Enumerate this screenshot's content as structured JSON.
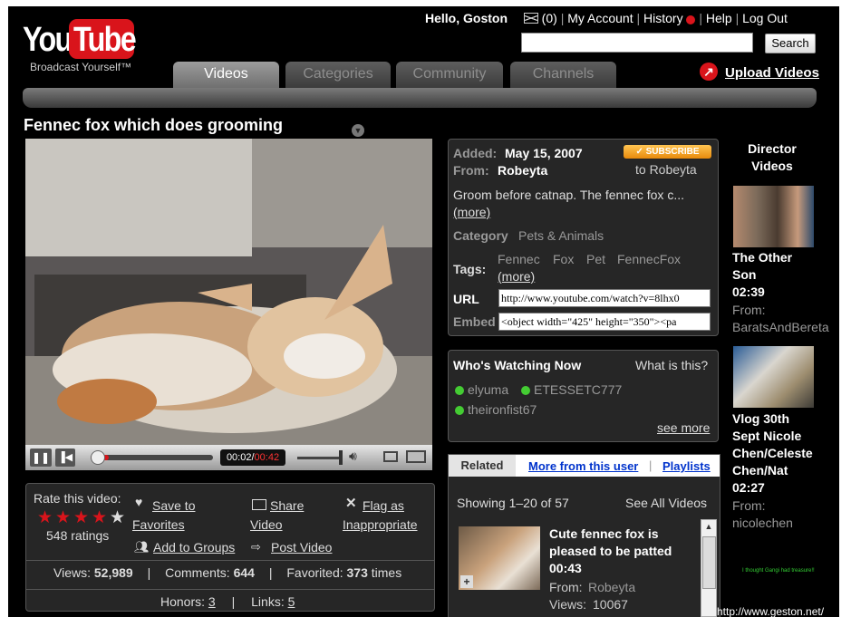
{
  "brand": {
    "name_you": "You",
    "name_tube": "Tube",
    "tagline": "Broadcast Yourself™"
  },
  "header": {
    "greeting": "Hello, Goston",
    "inbox_count": "(0)",
    "my_account": "My Account",
    "history": "History",
    "help": "Help",
    "logout": "Log Out",
    "search_placeholder": "",
    "search_button": "Search",
    "upload": "Upload Videos"
  },
  "nav": {
    "tabs": [
      {
        "label": "Videos",
        "active": true
      },
      {
        "label": "Categories",
        "active": false
      },
      {
        "label": "Community",
        "active": false
      },
      {
        "label": "Channels",
        "active": false
      }
    ]
  },
  "video": {
    "title": "Fennec fox which does grooming",
    "time_current": "00:02",
    "time_sep": "/",
    "time_total": "00:42",
    "progress": 0.05
  },
  "rating": {
    "label": "Rate this video:",
    "stars": 4,
    "count": "548 ratings"
  },
  "actions": {
    "save_favorites_1": "Save to",
    "save_favorites_2": "Favorites",
    "share_1": "Share",
    "share_2": "Video",
    "flag_1": "Flag as",
    "flag_2": "Inappropriate",
    "add_groups": "Add to Groups",
    "post_video": "Post Video"
  },
  "stats": {
    "views_label": "Views:",
    "views": "52,989",
    "comments_label": "Comments:",
    "comments": "644",
    "favorited_label": "Favorited:",
    "favorited": "373",
    "times": "times",
    "honors_label": "Honors:",
    "honors": "3",
    "links_label": "Links:",
    "links": "5"
  },
  "info": {
    "added_label": "Added:",
    "added": "May 15, 2007",
    "from_label": "From:",
    "from": "Robeyta",
    "subscribe": "SUBSCRIBE",
    "subscribe_to": "to Robeyta",
    "description": "Groom before catnap. The fennec fox c...",
    "more": "(more)",
    "category_label": "Category",
    "category": "Pets & Animals",
    "tags_label": "Tags:",
    "tags": [
      "Fennec",
      "Fox",
      "Pet",
      "FennecFox"
    ],
    "tags_more": "(more)",
    "url_label": "URL",
    "url": "http://www.youtube.com/watch?v=8lhx0",
    "embed_label": "Embed",
    "embed": "<object width=\"425\" height=\"350\"><pa"
  },
  "watching": {
    "title": "Who's Watching Now",
    "what": "What is this?",
    "users": [
      "elyuma",
      "ETESSETC777",
      "theironfist67"
    ],
    "see_more": "see more"
  },
  "related": {
    "tabs": [
      "Related",
      "More from this user",
      "Playlists"
    ],
    "showing": "Showing 1–20 of 57",
    "see_all": "See All Videos",
    "items": [
      {
        "title_1": "Cute fennec fox is",
        "title_2": "pleased to be patted",
        "duration": "00:43",
        "from_label": "From:",
        "from": "Robeyta",
        "views_label": "Views:",
        "views": "10067"
      }
    ]
  },
  "director": {
    "title_1": "Director",
    "title_2": "Videos",
    "items": [
      {
        "title_1": "The Other",
        "title_2": "Son",
        "duration": "02:39",
        "from_label": "From:",
        "from": "BaratsAndBereta"
      },
      {
        "title_1": "Vlog 30th",
        "title_2": "Sept Nicole",
        "title_3": "Chen/Celeste",
        "title_4": "Chen/Nat",
        "duration": "02:27",
        "from_label": "From:",
        "from": "nicolechen"
      }
    ],
    "ad_text": "I thought Gangi had treasure!!"
  },
  "watermark": "http://www.geston.net/",
  "colors": {
    "brand_red": "#d9141b",
    "subscribe_orange": "#f19a14",
    "online_green": "#44cc33",
    "link_blue": "#0033cc"
  }
}
